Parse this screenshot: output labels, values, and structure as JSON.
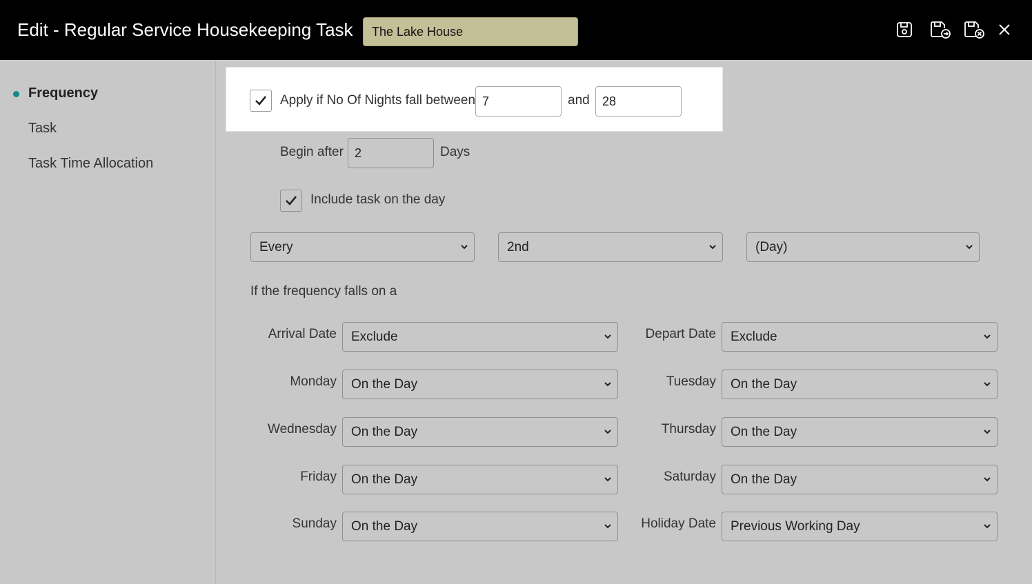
{
  "header": {
    "title": "Edit - Regular Service Housekeeping Task",
    "property": "The Lake House",
    "icons": [
      "save-icon",
      "save-and-copy-icon",
      "save-and-close-icon",
      "close-icon"
    ]
  },
  "sidebar": {
    "items": [
      {
        "label": "Frequency",
        "active": true
      },
      {
        "label": "Task",
        "active": false
      },
      {
        "label": "Task Time Allocation",
        "active": false
      }
    ]
  },
  "nights": {
    "checked": true,
    "label": "Apply if No Of Nights fall between",
    "from": "7",
    "and_label": "and",
    "to": "28"
  },
  "begin": {
    "label": "Begin after",
    "value": "2",
    "unit": "Days"
  },
  "include": {
    "checked": true,
    "label": "Include task on the day"
  },
  "frequency": {
    "every": "Every",
    "interval": "2nd",
    "period": "(Day)"
  },
  "falls_label": "If the frequency falls on a",
  "rules": {
    "arrival": {
      "label": "Arrival Date",
      "value": "Exclude"
    },
    "depart": {
      "label": "Depart Date",
      "value": "Exclude"
    },
    "monday": {
      "label": "Monday",
      "value": "On the Day"
    },
    "tuesday": {
      "label": "Tuesday",
      "value": "On the Day"
    },
    "wednesday": {
      "label": "Wednesday",
      "value": "On the Day"
    },
    "thursday": {
      "label": "Thursday",
      "value": "On the Day"
    },
    "friday": {
      "label": "Friday",
      "value": "On the Day"
    },
    "saturday": {
      "label": "Saturday",
      "value": "On the Day"
    },
    "sunday": {
      "label": "Sunday",
      "value": "On the Day"
    },
    "holiday": {
      "label": "Holiday Date",
      "value": "Previous Working Day"
    }
  },
  "colors": {
    "header_bg": "#000000",
    "property_field": "#c3bf96",
    "accent": "#0f8c8c",
    "background": "#c8c8c8"
  }
}
